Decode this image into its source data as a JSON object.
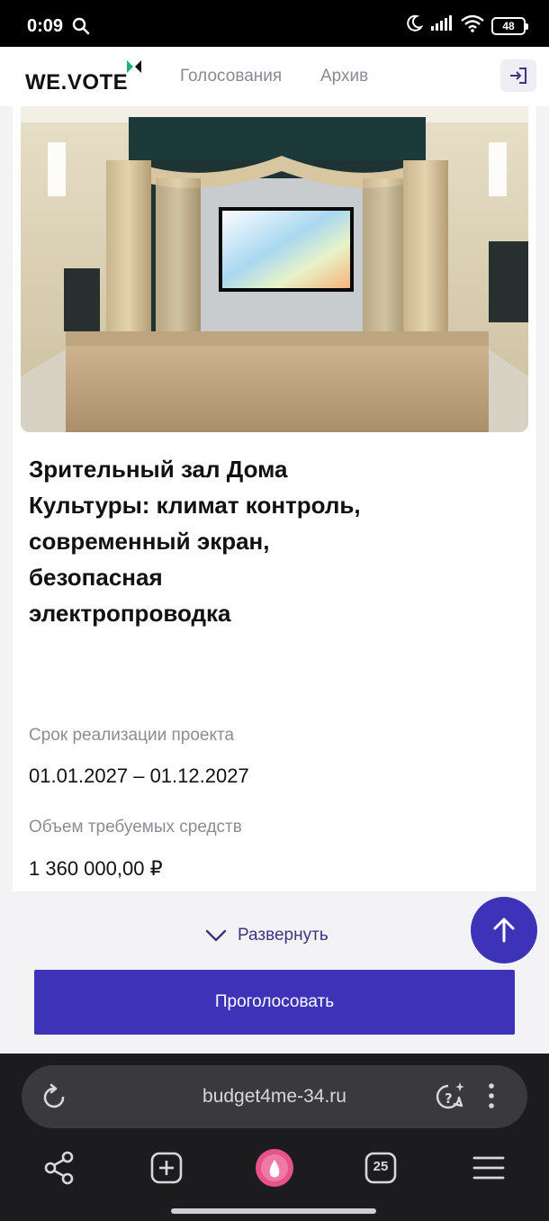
{
  "status_bar": {
    "time": "0:09",
    "battery": "48"
  },
  "header": {
    "logo": "WE.VOTE",
    "nav": [
      "Голосования",
      "Архив"
    ]
  },
  "project": {
    "title": "Зрительный зал Дома Культуры: климат контроль, современный экран, безопасная электропроводка",
    "period_label": "Срок реализации проекта",
    "period_value": "01.01.2027 – 01.12.2027",
    "funds_label": "Объем требуемых средств",
    "funds_value": "1 360 000,00 ₽"
  },
  "expand_label": "Развернуть",
  "vote_button": "Проголосовать",
  "browser": {
    "url": "budget4me-34.ru",
    "tabs_count": "25"
  },
  "colors": {
    "accent": "#3d33b9",
    "logo_mark": "#1fae7a"
  }
}
